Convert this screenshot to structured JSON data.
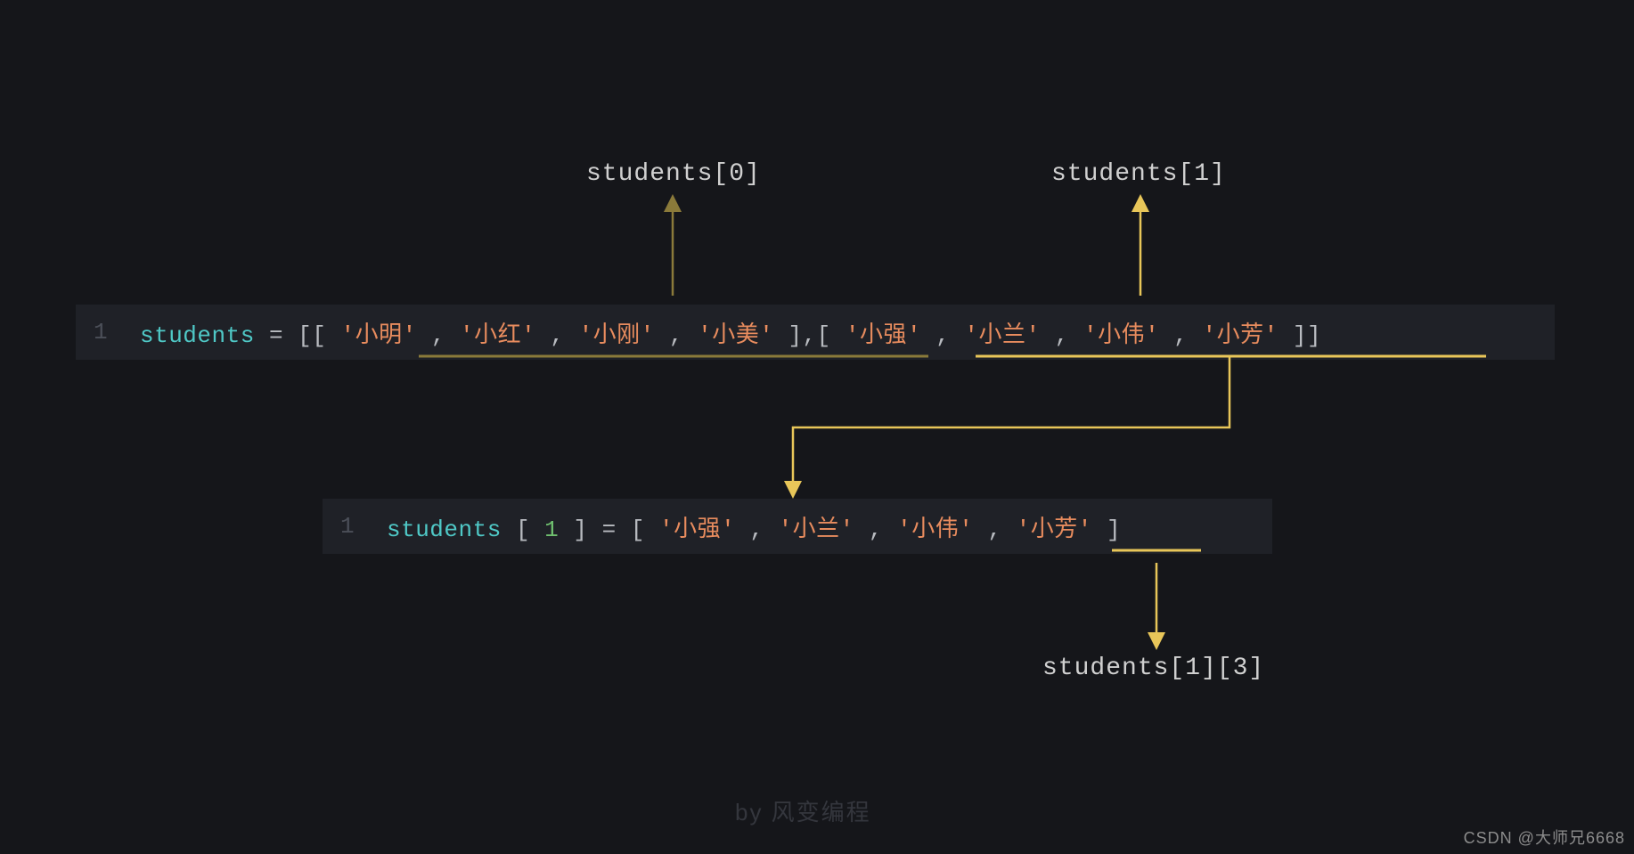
{
  "labels": {
    "top_left": "students[0]",
    "top_right": "students[1]",
    "bottom": "students[1][3]"
  },
  "code1": {
    "line_no": "1",
    "var_name": "students",
    "eq": " = ",
    "open": "[[",
    "s1a": "'小明'",
    "c1": ",",
    "s1b": "'小红'",
    "c2": ",",
    "s1c": "'小刚'",
    "c3": ",",
    "s1d": "'小美'",
    "mid": "],[",
    "s2a": "'小强'",
    "c4": ",",
    "s2b": "'小兰'",
    "c5": ",",
    "s2c": "'小伟'",
    "c6": ",",
    "s2d": "'小芳'",
    "close": "]]"
  },
  "code2": {
    "line_no": "1",
    "var_name": "students",
    "lbr": "[",
    "idx": "1",
    "rbr": "]",
    "eq": " = ",
    "open": "[",
    "a": "'小强'",
    "c1": ",",
    "b": "'小兰'",
    "c2": ",",
    "c": "'小伟'",
    "c3": ",",
    "d": "'小芳'",
    "close": "]"
  },
  "watermark": "by 风变编程",
  "corner": "CSDN @大师兄6668",
  "colors": {
    "accent_dark": "#8a7a3a",
    "accent_bright": "#e8c659"
  }
}
